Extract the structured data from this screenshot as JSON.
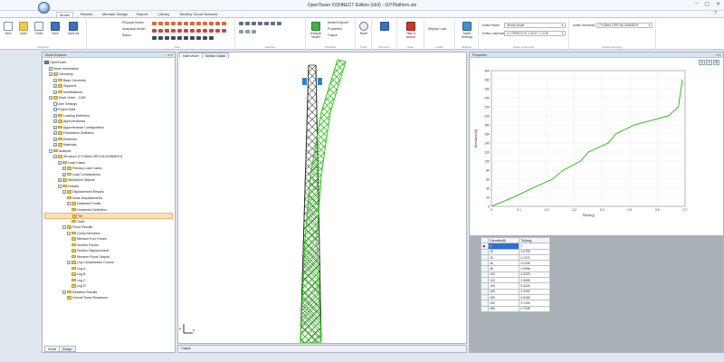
{
  "app": {
    "title": "OpenTower CONNECT Edition (x64) - 107Platform.otx",
    "window_controls": [
      "–",
      "▢",
      "✕"
    ],
    "help": "?"
  },
  "tabs": [
    "Model",
    "Results",
    "Member Design",
    "Report",
    "Library",
    "Bentley Cloud Services"
  ],
  "ribbon": {
    "standard": {
      "label": "Standard",
      "buttons": [
        "New",
        "Open",
        "Close",
        "Save",
        "Save As"
      ]
    },
    "view": {
      "label": "View",
      "physical": "Physical Model",
      "analytical": "Analytical Model",
      "status": "Status"
    },
    "selection": {
      "label": "Selection"
    },
    "windows": {
      "label": "Windows",
      "analyze": "Analyze Model",
      "explorer": "Model Explorer",
      "properties": "Properties",
      "output": "Output"
    },
    "tools": {
      "label": "Tools",
      "north": "North"
    },
    "structure": {
      "label": "Structure"
    },
    "snap": {
      "label": "Snap",
      "take": "Take a picture"
    },
    "loads": {
      "label": "Loads",
      "display": "Display Load"
    },
    "settings": {
      "label": "Settings",
      "tower": "Tower Settings"
    },
    "active_load_case": {
      "label": "Active Load Case",
      "model_label": "Active Model",
      "model_value": "Whole Model",
      "case_label": "Active Loadcase",
      "case_value": "LC FREE74 HI: 1.20 D + 1.0 W"
    },
    "active_geometry": {
      "label": "Active Geometry",
      "geom_label": "Active Geometry",
      "geom_value": "TYVAbt4-ORF106-020808YH"
    }
  },
  "explorer": {
    "title": "Model Explorer",
    "bottom_tabs": [
      "Model",
      "Design"
    ],
    "items": [
      {
        "label": "OpenTower",
        "depth": 0,
        "icon": "tower-icon"
      },
      {
        "label": "Tower Information",
        "depth": 1,
        "icon": "doc"
      },
      {
        "label": "Geometry",
        "depth": 1,
        "icon": "folder",
        "exp": "-"
      },
      {
        "label": "Base Geometry",
        "depth": 2,
        "icon": "folder",
        "exp": "+"
      },
      {
        "label": "Supports",
        "depth": 2,
        "icon": "folder",
        "exp": "+"
      },
      {
        "label": "Modifications",
        "depth": 2,
        "icon": "folder",
        "exp": "+"
      },
      {
        "label": "Work Order - 1402",
        "depth": 1,
        "icon": "folder",
        "exp": "-"
      },
      {
        "label": "User Settings",
        "depth": 2,
        "icon": "doc"
      },
      {
        "label": "Project Data",
        "depth": 2,
        "icon": "doc"
      },
      {
        "label": "Loading Definition",
        "depth": 2,
        "icon": "folder",
        "exp": "+"
      },
      {
        "label": "Appurtenances",
        "depth": 2,
        "icon": "folder",
        "exp": "+"
      },
      {
        "label": "Appurtenance Configuration",
        "depth": 2,
        "icon": "folder",
        "exp": "+"
      },
      {
        "label": "Foundation Definition",
        "depth": 2,
        "icon": "folder",
        "exp": "+"
      },
      {
        "label": "Elements",
        "depth": 2,
        "icon": "folder",
        "exp": "+"
      },
      {
        "label": "Materials",
        "depth": 2,
        "icon": "folder",
        "exp": "+"
      },
      {
        "label": "Analysis",
        "depth": 1,
        "icon": "folder",
        "exp": "-"
      },
      {
        "label": "Structure (TYVAbt4-ORF106-020808YH)",
        "depth": 2,
        "icon": "folder",
        "exp": "-"
      },
      {
        "label": "Load Cases",
        "depth": 3,
        "icon": "folder",
        "exp": "-"
      },
      {
        "label": "Primary Load Cases",
        "depth": 4,
        "icon": "folder",
        "exp": "+"
      },
      {
        "label": "Load Combinations",
        "depth": 4,
        "icon": "folder",
        "exp": "+"
      },
      {
        "label": "WindWork Objects",
        "depth": 3,
        "icon": "folder",
        "exp": "+"
      },
      {
        "label": "Results",
        "depth": 3,
        "icon": "folder",
        "exp": "-"
      },
      {
        "label": "Displacement Results",
        "depth": 4,
        "icon": "folder",
        "exp": "-"
      },
      {
        "label": "Node Displacements",
        "depth": 5,
        "icon": "folder"
      },
      {
        "label": "Deflected Profile",
        "depth": 5,
        "icon": "folder",
        "exp": "-"
      },
      {
        "label": "Horizontal Deflection",
        "depth": 6,
        "icon": "folder"
      },
      {
        "label": "Tilt",
        "depth": 6,
        "icon": "folder",
        "selected": true
      },
      {
        "label": "Twist",
        "depth": 6,
        "icon": "folder"
      },
      {
        "label": "Force Results",
        "depth": 4,
        "icon": "folder",
        "exp": "-"
      },
      {
        "label": "Linear Members",
        "depth": 5,
        "icon": "folder",
        "exp": "-"
      },
      {
        "label": "Member End Forces",
        "depth": 6,
        "icon": "folder"
      },
      {
        "label": "Section Forces",
        "depth": 6,
        "icon": "folder"
      },
      {
        "label": "Section Displacement",
        "depth": 6,
        "icon": "folder"
      },
      {
        "label": "Member Force Graphs",
        "depth": 6,
        "icon": "folder"
      },
      {
        "label": "Leg Compression Curves",
        "depth": 5,
        "icon": "folder",
        "exp": "-"
      },
      {
        "label": "Leg A",
        "depth": 6,
        "icon": "folder"
      },
      {
        "label": "Leg B",
        "depth": 6,
        "icon": "folder"
      },
      {
        "label": "Leg C",
        "depth": 6,
        "icon": "folder"
      },
      {
        "label": "Leg D",
        "depth": 6,
        "icon": "folder"
      },
      {
        "label": "Reaction Results",
        "depth": 4,
        "icon": "folder",
        "exp": "-"
      },
      {
        "label": "Overall Tower Reactions",
        "depth": 5,
        "icon": "folder"
      }
    ]
  },
  "view": {
    "tabs": [
      "Main Model",
      "Section Global"
    ],
    "output_label": "Output"
  },
  "properties": {
    "title": "Properties",
    "buttons": [
      "↻",
      "✎",
      "⊞"
    ]
  },
  "chart_data": {
    "type": "line",
    "title": "",
    "xlabel": "Tilt(deg)",
    "ylabel": "Elevation(ft)",
    "xlim": [
      0,
      0.7
    ],
    "ylim": [
      0,
      300
    ],
    "xticks": [
      "0",
      "0.1",
      "0.2",
      "0.3",
      "0.4",
      "0.5",
      "0.6",
      "0.7"
    ],
    "yticks": [
      "0",
      "20",
      "40",
      "60",
      "80",
      "100",
      "120",
      "140",
      "160",
      "180",
      "200",
      "220",
      "240",
      "260",
      "280",
      "300"
    ],
    "series": [
      {
        "color": "#35c11f",
        "x": [
          0,
          0.0799,
          0.1472,
          0.2208,
          0.2596,
          0.3223,
          0.3505,
          0.4224,
          0.4492,
          0.5169,
          0.64,
          0.676,
          0.69
        ],
        "y": [
          0,
          20,
          40,
          60,
          80,
          100,
          120,
          140,
          160,
          180,
          200,
          220,
          280
        ]
      }
    ]
  },
  "table": {
    "headers": [
      "Elevation(ft)",
      "Tilt(deg)"
    ],
    "rows": [
      [
        "0",
        "0"
      ],
      [
        "20",
        "0.0799"
      ],
      [
        "40",
        "0.1472"
      ],
      [
        "60",
        "0.2208"
      ],
      [
        "80",
        "0.2596"
      ],
      [
        "100",
        "0.3223"
      ],
      [
        "120",
        "0.3505"
      ],
      [
        "140",
        "0.4224"
      ],
      [
        "160",
        "0.4492"
      ],
      [
        "180",
        "0.5169"
      ],
      [
        "200",
        "0.7104"
      ],
      [
        "280",
        "0.7335"
      ]
    ]
  },
  "colors": {
    "accent": "#2f6fd0",
    "tree_selected": "#fbe0bf",
    "tower_deflected": "#35c11f",
    "tower": "#2d3a2d"
  }
}
